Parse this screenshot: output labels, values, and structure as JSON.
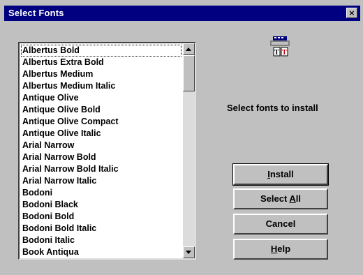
{
  "window": {
    "title": "Select Fonts",
    "close_label": "×"
  },
  "font_list": {
    "items": [
      "Albertus Bold",
      "Albertus Extra Bold",
      "Albertus Medium",
      "Albertus Medium Italic",
      "Antique Olive",
      "Antique Olive Bold",
      "Antique Olive Compact",
      "Antique Olive Italic",
      "Arial Narrow",
      "Arial Narrow Bold",
      "Arial Narrow Bold Italic",
      "Arial Narrow Italic",
      "Bodoni",
      "Bodoni Black",
      "Bodoni Bold",
      "Bodoni Bold Italic",
      "Bodoni Italic",
      "Book Antiqua"
    ],
    "selected_index": 0
  },
  "icon": {
    "name": "printer-fonts-icon"
  },
  "instruction_text": "Select fonts to install",
  "buttons": {
    "install": {
      "pre": "",
      "accel": "I",
      "post": "nstall"
    },
    "select_all": {
      "pre": "Select ",
      "accel": "A",
      "post": "ll"
    },
    "cancel": {
      "label": "Cancel"
    },
    "help": {
      "pre": "",
      "accel": "H",
      "post": "elp"
    }
  },
  "colors": {
    "titlebar": "#000080",
    "face": "#c0c0c0"
  }
}
